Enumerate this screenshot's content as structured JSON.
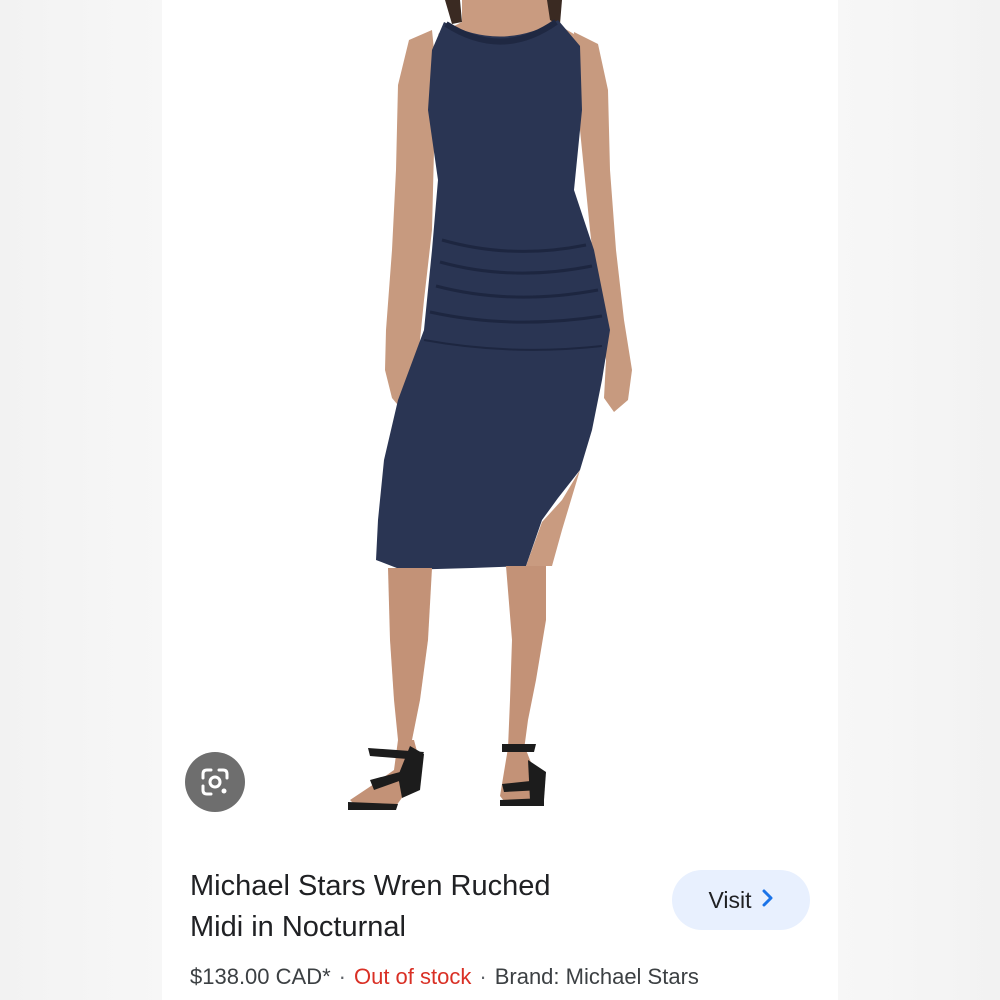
{
  "product": {
    "title_line1": "Michael Stars Wren Ruched",
    "title_line2": "Midi in Nocturnal",
    "price": "$138.00 CAD*",
    "stock_status": "Out of stock",
    "brand": "Brand: Michael Stars",
    "separator": "·"
  },
  "actions": {
    "visit_label": "Visit",
    "visit_icon": "chevron-right-icon",
    "lens_icon": "google-lens-icon"
  },
  "colors": {
    "dress": "#2a3553",
    "visit_bg": "#e8f0fe",
    "visit_chevron": "#1a73e8",
    "out_of_stock": "#d93025",
    "lens_bg": "#6e6e6e"
  }
}
